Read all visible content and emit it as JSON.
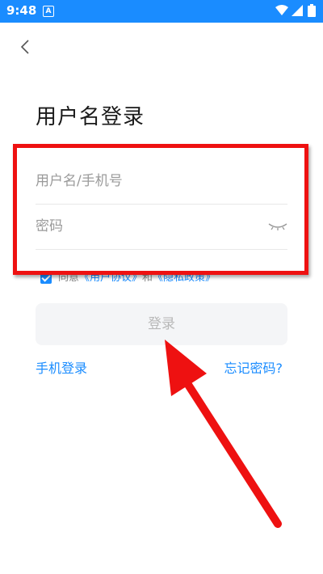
{
  "status_bar": {
    "time": "9:48",
    "notification_letter": "A"
  },
  "page": {
    "title": "用户名登录"
  },
  "form": {
    "username_placeholder": "用户名/手机号",
    "password_placeholder": "密码"
  },
  "agreement": {
    "checked": true,
    "prefix": "同意",
    "user_agreement": "《用户协议》",
    "conjunction": "和",
    "privacy_policy": "《隐私政策》"
  },
  "actions": {
    "login_label": "登录",
    "phone_login_label": "手机登录",
    "forgot_password_label": "忘记密码?"
  },
  "annotations": {
    "highlight_color": "#ee1111"
  },
  "colors": {
    "accent": "#1a8cff",
    "status_bar": "#1a8cff",
    "button_bg": "#f4f5f7"
  }
}
